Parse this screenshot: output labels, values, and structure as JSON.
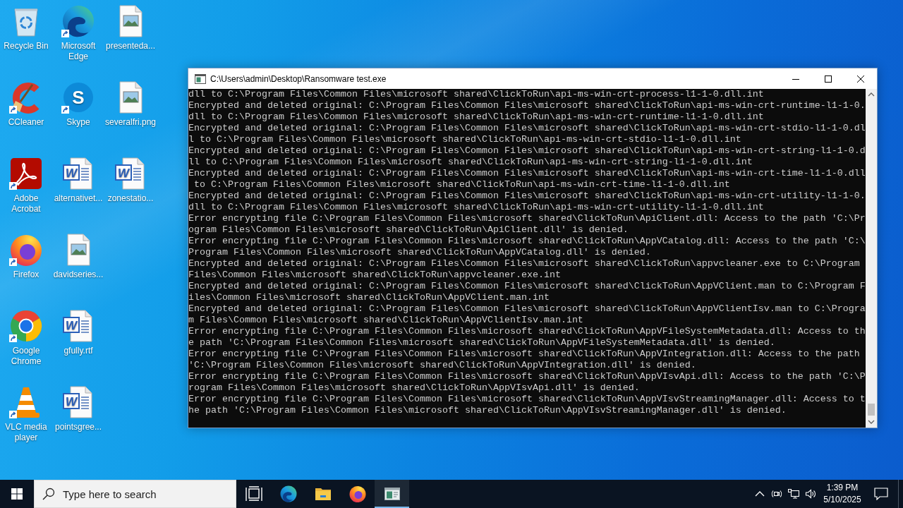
{
  "desktop": {
    "icons": [
      {
        "label": "Recycle Bin",
        "kind": "recycle-bin",
        "shortcut": false
      },
      {
        "label": "CCleaner",
        "kind": "ccleaner",
        "shortcut": true
      },
      {
        "label": "Adobe Acrobat",
        "kind": "acrobat",
        "shortcut": true
      },
      {
        "label": "Firefox",
        "kind": "firefox",
        "shortcut": true
      },
      {
        "label": "Google Chrome",
        "kind": "chrome",
        "shortcut": true
      },
      {
        "label": "VLC media player",
        "kind": "vlc",
        "shortcut": true
      },
      {
        "label": "Microsoft Edge",
        "kind": "edge",
        "shortcut": true
      },
      {
        "label": "Skype",
        "kind": "skype",
        "shortcut": true,
        "glyph": "S"
      },
      {
        "label": "alternativet...",
        "kind": "word-doc",
        "shortcut": false,
        "glyph": "W"
      },
      {
        "label": "davidseries...",
        "kind": "image-file",
        "shortcut": false
      },
      {
        "label": "gfully.rtf",
        "kind": "word-doc",
        "shortcut": false,
        "glyph": "W"
      },
      {
        "label": "pointsgree...",
        "kind": "word-doc",
        "shortcut": false,
        "glyph": "W"
      },
      {
        "label": "presenteda...",
        "kind": "image-file",
        "shortcut": false
      },
      {
        "label": "severalfri.png",
        "kind": "image-file",
        "shortcut": false
      },
      {
        "label": "zonestatio...",
        "kind": "word-doc",
        "shortcut": false,
        "glyph": "W"
      }
    ]
  },
  "window": {
    "title": "C:\\Users\\admin\\Desktop\\Ransomware test.exe",
    "console_lines": [
      "dll to C:\\Program Files\\Common Files\\microsoft shared\\ClickToRun\\api-ms-win-crt-process-l1-1-0.dll.int",
      "Encrypted and deleted original: C:\\Program Files\\Common Files\\microsoft shared\\ClickToRun\\api-ms-win-crt-runtime-l1-1-0.dll to C:\\Program Files\\Common Files\\microsoft shared\\ClickToRun\\api-ms-win-crt-runtime-l1-1-0.dll.int",
      "Encrypted and deleted original: C:\\Program Files\\Common Files\\microsoft shared\\ClickToRun\\api-ms-win-crt-stdio-l1-1-0.dll to C:\\Program Files\\Common Files\\microsoft shared\\ClickToRun\\api-ms-win-crt-stdio-l1-1-0.dll.int",
      "Encrypted and deleted original: C:\\Program Files\\Common Files\\microsoft shared\\ClickToRun\\api-ms-win-crt-string-l1-1-0.dll to C:\\Program Files\\Common Files\\microsoft shared\\ClickToRun\\api-ms-win-crt-string-l1-1-0.dll.int",
      "Encrypted and deleted original: C:\\Program Files\\Common Files\\microsoft shared\\ClickToRun\\api-ms-win-crt-time-l1-1-0.dll to C:\\Program Files\\Common Files\\microsoft shared\\ClickToRun\\api-ms-win-crt-time-l1-1-0.dll.int",
      "Encrypted and deleted original: C:\\Program Files\\Common Files\\microsoft shared\\ClickToRun\\api-ms-win-crt-utility-l1-1-0.dll to C:\\Program Files\\Common Files\\microsoft shared\\ClickToRun\\api-ms-win-crt-utility-l1-1-0.dll.int",
      "Error encrypting file C:\\Program Files\\Common Files\\microsoft shared\\ClickToRun\\ApiClient.dll: Access to the path 'C:\\Program Files\\Common Files\\microsoft shared\\ClickToRun\\ApiClient.dll' is denied.",
      "Error encrypting file C:\\Program Files\\Common Files\\microsoft shared\\ClickToRun\\AppVCatalog.dll: Access to the path 'C:\\Program Files\\Common Files\\microsoft shared\\ClickToRun\\AppVCatalog.dll' is denied.",
      "Encrypted and deleted original: C:\\Program Files\\Common Files\\microsoft shared\\ClickToRun\\appvcleaner.exe to C:\\Program Files\\Common Files\\microsoft shared\\ClickToRun\\appvcleaner.exe.int",
      "Encrypted and deleted original: C:\\Program Files\\Common Files\\microsoft shared\\ClickToRun\\AppVClient.man to C:\\Program Files\\Common Files\\microsoft shared\\ClickToRun\\AppVClient.man.int",
      "Encrypted and deleted original: C:\\Program Files\\Common Files\\microsoft shared\\ClickToRun\\AppVClientIsv.man to C:\\Program Files\\Common Files\\microsoft shared\\ClickToRun\\AppVClientIsv.man.int",
      "Error encrypting file C:\\Program Files\\Common Files\\microsoft shared\\ClickToRun\\AppVFileSystemMetadata.dll: Access to the path 'C:\\Program Files\\Common Files\\microsoft shared\\ClickToRun\\AppVFileSystemMetadata.dll' is denied.",
      "Error encrypting file C:\\Program Files\\Common Files\\microsoft shared\\ClickToRun\\AppVIntegration.dll: Access to the path 'C:\\Program Files\\Common Files\\microsoft shared\\ClickToRun\\AppVIntegration.dll' is denied.",
      "Error encrypting file C:\\Program Files\\Common Files\\microsoft shared\\ClickToRun\\AppVIsvApi.dll: Access to the path 'C:\\Program Files\\Common Files\\microsoft shared\\ClickToRun\\AppVIsvApi.dll' is denied.",
      "Error encrypting file C:\\Program Files\\Common Files\\microsoft shared\\ClickToRun\\AppVIsvStreamingManager.dll: Access to the path 'C:\\Program Files\\Common Files\\microsoft shared\\ClickToRun\\AppVIsvStreamingManager.dll' is denied."
    ]
  },
  "taskbar": {
    "search": {
      "placeholder": "Type here to search"
    },
    "apps": [
      {
        "kind": "task-view",
        "selected": false
      },
      {
        "kind": "edge",
        "selected": false
      },
      {
        "kind": "file-explorer",
        "selected": false
      },
      {
        "kind": "firefox",
        "selected": false
      },
      {
        "kind": "console",
        "selected": true
      }
    ],
    "clock": {
      "time": "1:39 PM",
      "date": "5/10/2025"
    }
  }
}
